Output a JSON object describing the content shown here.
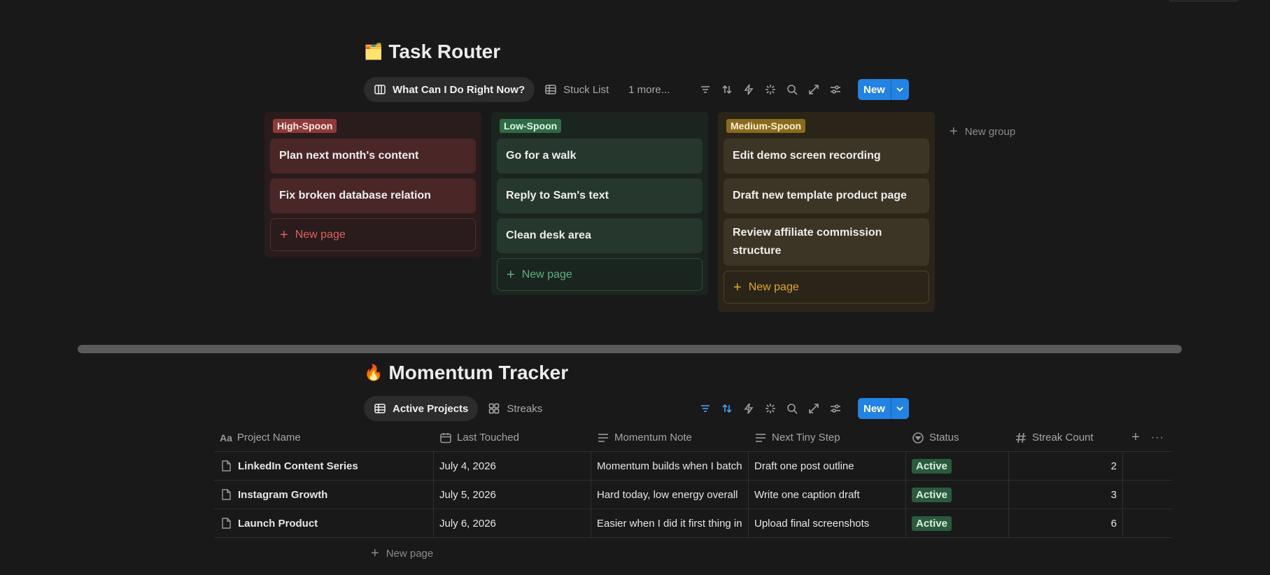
{
  "task_router": {
    "emoji": "🗂️",
    "title": "Task Router",
    "views": [
      {
        "label": "What Can I Do Right Now?",
        "icon": "board-icon"
      },
      {
        "label": "Stuck List",
        "icon": "table-icon"
      },
      {
        "label": "1 more...",
        "icon": ""
      }
    ],
    "new_label": "New",
    "columns": [
      {
        "tag": "High-Spoon",
        "cards": [
          "Plan next month's content",
          "Fix broken database relation"
        ],
        "new_page": "New page"
      },
      {
        "tag": "Low-Spoon",
        "cards": [
          "Go for a walk",
          "Reply to Sam's text",
          "Clean desk area"
        ],
        "new_page": "New page"
      },
      {
        "tag": "Medium-Spoon",
        "cards": [
          "Edit demo screen recording",
          "Draft new template product page",
          "Review affiliate commission structure"
        ],
        "new_page": "New page"
      }
    ],
    "new_group": "New group"
  },
  "momentum_tracker": {
    "emoji": "🔥",
    "title": "Momentum Tracker",
    "views": [
      {
        "label": "Active Projects",
        "icon": "table-icon"
      },
      {
        "label": "Streaks",
        "icon": "gallery-icon"
      }
    ],
    "new_label": "New",
    "columns": [
      "Project Name",
      "Last Touched",
      "Momentum Note",
      "Next Tiny Step",
      "Status",
      "Streak Count"
    ],
    "rows": [
      {
        "name": "LinkedIn Content Series",
        "last_touched": "July 4, 2026",
        "note": "Momentum builds when I batch",
        "next_step": "Draft one post outline",
        "status": "Active",
        "streak": "2"
      },
      {
        "name": "Instagram Growth",
        "last_touched": "July 5, 2026",
        "note": "Hard today, low energy overall",
        "next_step": "Write one caption draft",
        "status": "Active",
        "streak": "3"
      },
      {
        "name": "Launch Product",
        "last_touched": "July 6, 2026",
        "note": "Easier when I did it first thing in",
        "next_step": "Upload final screenshots",
        "status": "Active",
        "streak": "6"
      }
    ],
    "new_page": "New page"
  },
  "colors": {
    "high": {
      "bg": "#2a1c1c",
      "card": "#4a2626",
      "tag": "#8e3a3a",
      "accent": "#e06060"
    },
    "low": {
      "bg": "#1b2520",
      "card": "#26382d",
      "tag": "#2f6b44",
      "accent": "#5fb07a"
    },
    "medium": {
      "bg": "#2a2518",
      "card": "#3c3525",
      "tag": "#8a6a1e",
      "accent": "#e0a53a"
    }
  }
}
